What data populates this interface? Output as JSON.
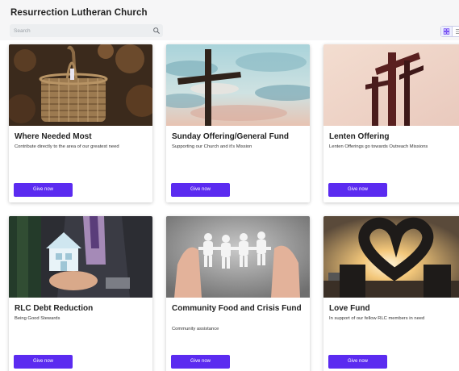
{
  "header": {
    "title": "Resurrection Lutheran Church",
    "search_placeholder": "Search"
  },
  "icons": {
    "search": "search-icon",
    "grid_view": "grid-view-icon",
    "list_view": "list-view-icon"
  },
  "colors": {
    "accent": "#5b2bf0",
    "background": "#f6f6f7"
  },
  "funds": [
    {
      "title": "Where Needed Most",
      "description": "Contribute directly to the area of our greatest need",
      "button": "Give now",
      "image": "wicker-basket"
    },
    {
      "title": "Sunday Offering/General Fund",
      "description": "Supporting our Church and it's Mission",
      "button": "Give now",
      "image": "cross-and-sky"
    },
    {
      "title": "Lenten Offering",
      "description": "Lenten Offerings go towards Outreach Missions",
      "button": "Give now",
      "image": "wooden-crosses"
    },
    {
      "title": "RLC Debt Reduction",
      "description": "Being Good Stewards",
      "button": "Give now",
      "image": "paper-house-in-hand"
    },
    {
      "title": "Community Food and Crisis Fund",
      "description": "Community assistance",
      "button": "Give now",
      "image": "paper-people-chain"
    },
    {
      "title": "Love Fund",
      "description": "In support of our fellow RLC members in need",
      "button": "Give now",
      "image": "heart-hands-sunset"
    }
  ]
}
